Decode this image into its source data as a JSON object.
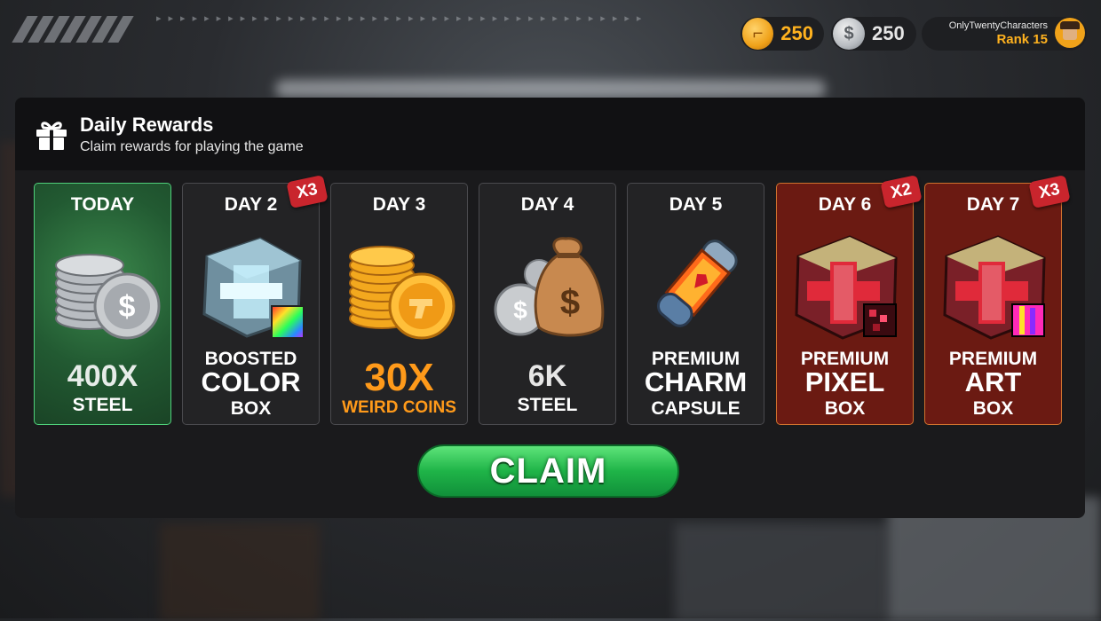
{
  "currencies": [
    {
      "name": "weird-coins",
      "value": "250",
      "color": "#ffb21f"
    },
    {
      "name": "steel",
      "value": "250",
      "color": "#e6e6e6"
    }
  ],
  "profile": {
    "username": "OnlyTwentyCharacters",
    "rank": "Rank 15"
  },
  "panel": {
    "title": "Daily Rewards",
    "subtitle": "Claim rewards for playing the game"
  },
  "cards": [
    {
      "day": "TODAY",
      "line1": "400X",
      "line2": "STEEL",
      "line3": "",
      "badge": "",
      "icon": "steel-coins-icon"
    },
    {
      "day": "DAY 2",
      "line1": "BOOSTED",
      "line2": "COLOR",
      "line3": "BOX",
      "badge": "X3",
      "icon": "boosted-color-box-icon"
    },
    {
      "day": "DAY 3",
      "line1": "30X",
      "line2": "WEIRD COINS",
      "line3": "",
      "badge": "",
      "icon": "weird-coins-icon"
    },
    {
      "day": "DAY 4",
      "line1": "6K",
      "line2": "STEEL",
      "line3": "",
      "badge": "",
      "icon": "money-bag-icon"
    },
    {
      "day": "DAY 5",
      "line1": "PREMIUM",
      "line2": "CHARM",
      "line3": "CAPSULE",
      "badge": "",
      "icon": "charm-capsule-icon"
    },
    {
      "day": "DAY 6",
      "line1": "PREMIUM",
      "line2": "PIXEL",
      "line3": "BOX",
      "badge": "X2",
      "icon": "pixel-box-icon"
    },
    {
      "day": "DAY 7",
      "line1": "PREMIUM",
      "line2": "ART",
      "line3": "BOX",
      "badge": "X3",
      "icon": "art-box-icon"
    }
  ],
  "claim_label": "CLAIM",
  "colors": {
    "accent_gold": "#ffb21f",
    "today_green": "#4fd07a",
    "premium_red": "#6b1a12",
    "claim_green": "#1fb448",
    "badge_red": "#c9252d"
  }
}
